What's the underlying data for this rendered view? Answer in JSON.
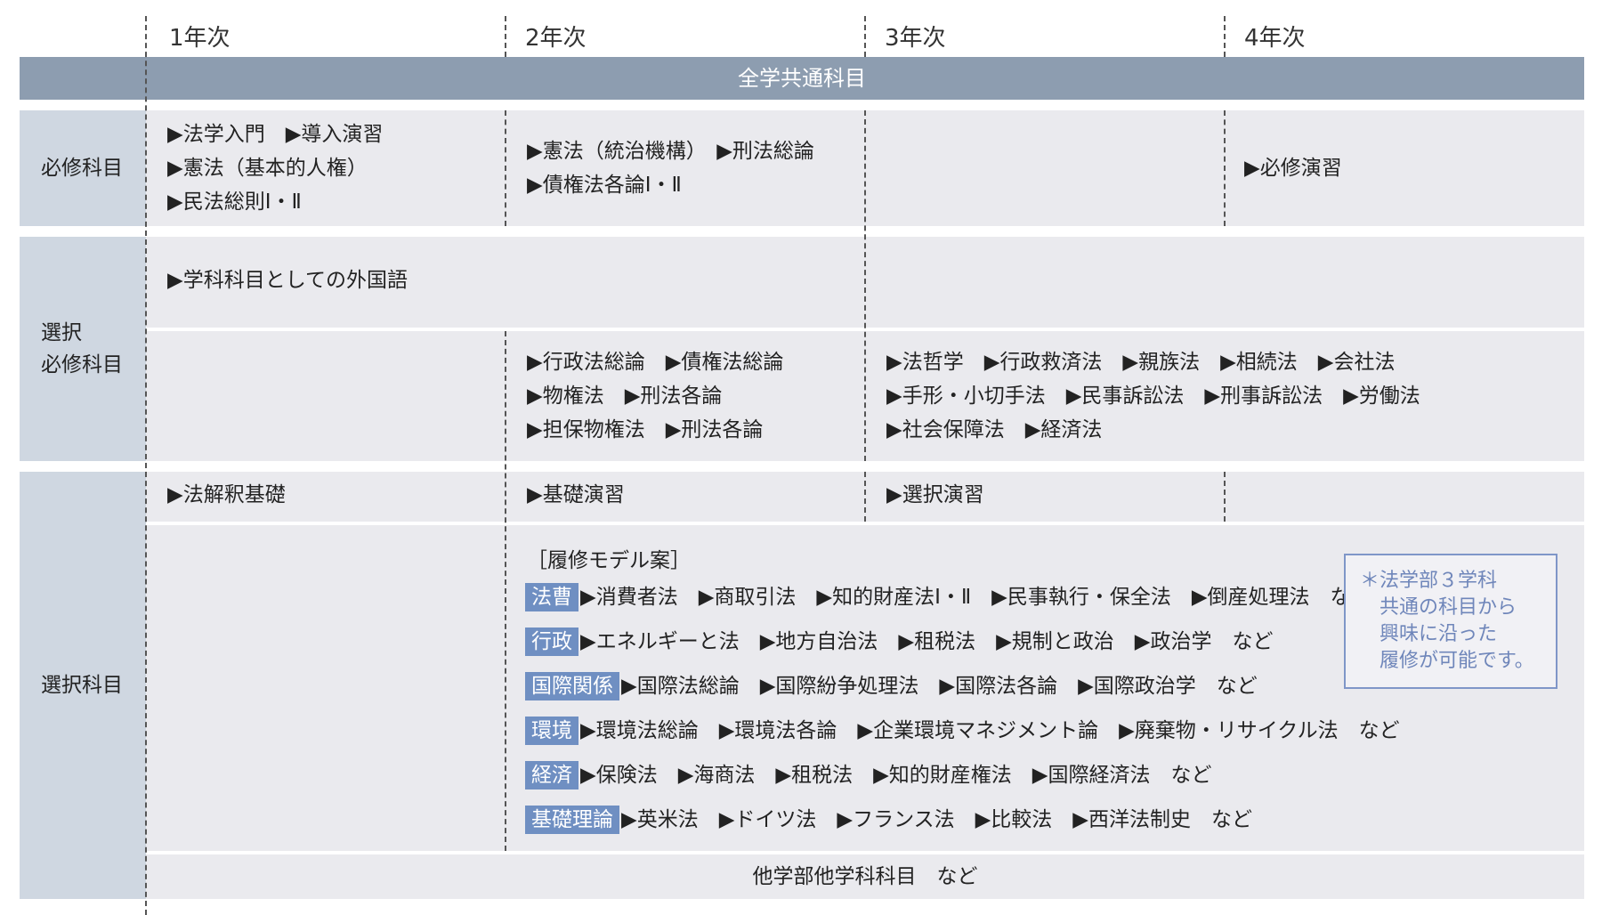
{
  "years": [
    "1年次",
    "2年次",
    "3年次",
    "4年次"
  ],
  "common_band": "全学共通科目",
  "rows": {
    "required": {
      "label": "必修科目",
      "y1": [
        "▶法学入門　▶導入演習",
        "▶憲法（基本的人権）",
        "▶民法総則Ⅰ・Ⅱ"
      ],
      "y2": [
        "▶憲法（統治機構）　▶刑法総論",
        "▶債権法各論Ⅰ・Ⅱ"
      ],
      "y4": [
        "▶必修演習"
      ]
    },
    "selective_required": {
      "label_line1": "選択",
      "label_line2": "必修科目",
      "foreign": "▶学科科目としての外国語",
      "y2": [
        "▶行政法総論　▶債権法総論",
        "▶物権法　▶刑法各論",
        "▶担保物権法　▶刑法各論"
      ],
      "y34": [
        "▶法哲学　▶行政救済法　▶親族法　▶相続法　▶会社法",
        "▶手形・小切手法　▶民事訴訟法　▶刑事訴訟法　▶労働法",
        "▶社会保障法　▶経済法"
      ]
    },
    "elective": {
      "label": "選択科目",
      "y1": "▶法解釈基礎",
      "y2": "▶基礎演習",
      "y3": "▶選択演習",
      "model_title": "［履修モデル案］",
      "models": [
        {
          "tag": "法曹",
          "text": "▶消費者法　▶商取引法　▶知的財産法Ⅰ・Ⅱ　▶民事執行・保全法　▶倒産処理法　など"
        },
        {
          "tag": "行政",
          "text": "▶エネルギーと法　▶地方自治法　▶租税法　▶規制と政治　▶政治学　など"
        },
        {
          "tag": "国際関係",
          "text": "▶国際法総論　▶国際紛争処理法　▶国際法各論　▶国際政治学　など"
        },
        {
          "tag": "環境",
          "text": "▶環境法総論　▶環境法各論　▶企業環境マネジメント論　▶廃棄物・リサイクル法　など"
        },
        {
          "tag": "経済",
          "text": "▶保険法　▶海商法　▶租税法　▶知的財産権法　▶国際経済法　など"
        },
        {
          "tag": "基礎理論",
          "text": "▶英米法　▶ドイツ法　▶フランス法　▶比較法　▶西洋法制史　など"
        }
      ],
      "note": [
        "＊法学部３学科",
        "　共通の科目から",
        "　興味に沿った",
        "　履修が可能です。"
      ],
      "other": "他学部他学科科目　など"
    }
  },
  "colors": {
    "band": "#8d9db0",
    "label_bg": "#cfd7e1",
    "cell_bg": "#eaeaee",
    "tag": "#6f8fc2"
  }
}
